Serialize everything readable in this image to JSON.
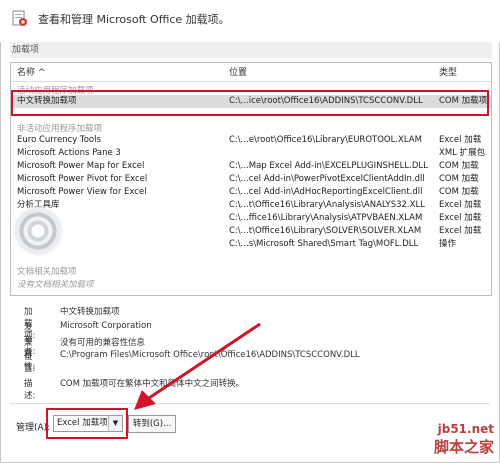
{
  "header": {
    "title": "查看和管理 Microsoft Office 加载项。"
  },
  "section": {
    "label": "加载项"
  },
  "columns": {
    "name": "名称 ^",
    "location": "位置",
    "type": "类型"
  },
  "groups": {
    "active": "活动应用程序加载项",
    "inactive": "非活动应用程序加载项",
    "document": "文档相关加载项",
    "no_document": "没有文档相关加载项"
  },
  "active_rows": [
    {
      "name": "中文转换加载项",
      "location": "C:\\...ice\\root\\Office16\\ADDINS\\TCSCCONV.DLL",
      "type": "COM 加载项"
    }
  ],
  "inactive_rows": [
    {
      "name": "Euro Currency Tools",
      "location": "C:\\...e\\root\\Office16\\Library\\EUROTOOL.XLAM",
      "type": "Excel 加载"
    },
    {
      "name": "Microsoft Actions Pane 3",
      "location": "",
      "type": "XML 扩展包"
    },
    {
      "name": "Microsoft Power Map for Excel",
      "location": "C:\\...Map Excel Add-in\\EXCELPLUGINSHELL.DLL",
      "type": "COM 加载"
    },
    {
      "name": "Microsoft Power Pivot for Excel",
      "location": "C:\\...cel Add-in\\PowerPivotExcelClientAddIn.dll",
      "type": "COM 加载"
    },
    {
      "name": "Microsoft Power View for Excel",
      "location": "C:\\...cel Add-in\\AdHocReportingExcelClient.dll",
      "type": "COM 加载"
    },
    {
      "name": "分析工具库",
      "location": "C:\\...t\\Office16\\Library\\Analysis\\ANALYS32.XLL",
      "type": "Excel 加载"
    },
    {
      "name": "",
      "location": "C:\\...ffice16\\Library\\Analysis\\ATPVBAEN.XLAM",
      "type": "Excel 加载"
    },
    {
      "name": "",
      "location": "C:\\...t\\Office16\\Library\\SOLVER\\SOLVER.XLAM",
      "type": "Excel 加载"
    },
    {
      "name": "",
      "location": "C:\\...s\\Microsoft Shared\\Smart Tag\\MOFL.DLL",
      "type": "操作"
    }
  ],
  "details": {
    "addin_label": "加载项:",
    "addin_value": "中文转换加载项",
    "publisher_label": "发布者:",
    "publisher_value": "Microsoft Corporation",
    "compat_label": "兼容性:",
    "compat_value": "没有可用的兼容性信息",
    "location_label": "位置:",
    "location_value": "C:\\Program Files\\Microsoft Office\\root\\Office16\\ADDINS\\TCSCCONV.DLL",
    "desc_label": "描述:",
    "desc_value": "COM 加载项可在繁体中文和简体中文之间转换。"
  },
  "manage": {
    "label": "管理(A):",
    "selected": "Excel 加载项",
    "go_button": "转到(G)..."
  },
  "watermark": {
    "line1": "jb51.net",
    "line2": "脚本之家"
  },
  "colors": {
    "highlight": "#d0152a",
    "selection": "#dcdcdc"
  }
}
